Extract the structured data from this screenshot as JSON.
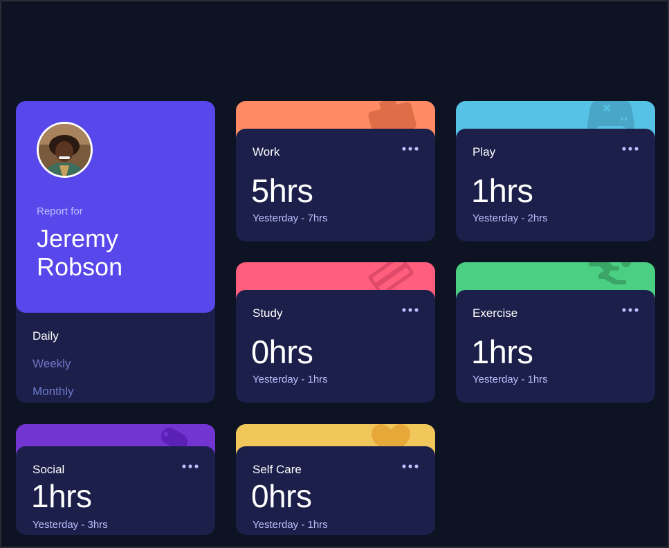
{
  "profile": {
    "report_label": "Report for",
    "name": "Jeremy Robson"
  },
  "periods": [
    {
      "label": "Daily",
      "active": true
    },
    {
      "label": "Weekly",
      "active": false
    },
    {
      "label": "Monthly",
      "active": false
    }
  ],
  "activities": [
    {
      "title": "Work",
      "hours": "5hrs",
      "previous": "Yesterday - 7hrs",
      "color": "#ff8b64",
      "icon": "briefcase-icon"
    },
    {
      "title": "Play",
      "hours": "1hrs",
      "previous": "Yesterday - 2hrs",
      "color": "#55c2e6",
      "icon": "gamepad-icon"
    },
    {
      "title": "Study",
      "hours": "0hrs",
      "previous": "Yesterday - 1hrs",
      "color": "#ff5e7d",
      "icon": "books-icon"
    },
    {
      "title": "Exercise",
      "hours": "1hrs",
      "previous": "Yesterday - 1hrs",
      "color": "#4bcf82",
      "icon": "runner-icon"
    },
    {
      "title": "Social",
      "hours": "1hrs",
      "previous": "Yesterday - 3hrs",
      "color": "#7335d2",
      "icon": "chat-bubble-icon"
    },
    {
      "title": "Self Care",
      "hours": "0hrs",
      "previous": "Yesterday - 1hrs",
      "color": "#f1c75b",
      "icon": "heart-icon"
    }
  ],
  "colors": {
    "page_bg": "#0e1323",
    "card_bg": "#1c1f4a",
    "accent": "#5847eb",
    "muted_text": "#bbc0ff",
    "inactive_link": "#7078c9"
  }
}
